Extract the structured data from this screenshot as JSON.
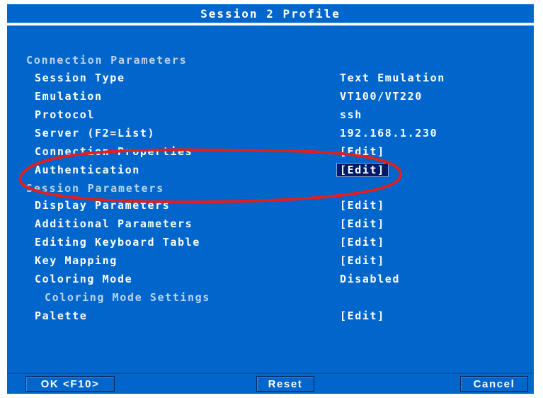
{
  "window": {
    "title": "Session 2 Profile"
  },
  "sections": {
    "connection": "Connection Parameters",
    "session": "Session Parameters"
  },
  "connection_rows": [
    {
      "label": "Session Type",
      "value": "Text Emulation"
    },
    {
      "label": "Emulation",
      "value": "VT100/VT220"
    },
    {
      "label": "Protocol",
      "value": "ssh"
    },
    {
      "label": "Server (F2=List)",
      "value": "192.168.1.230"
    },
    {
      "label": "Connection Properties",
      "value": "[Edit]"
    },
    {
      "label": "Authentication",
      "value": "[Edit]",
      "selected": true
    }
  ],
  "session_rows": [
    {
      "label": "Display Parameters",
      "value": "[Edit]"
    },
    {
      "label": "Additional Parameters",
      "value": "[Edit]"
    },
    {
      "label": "Editing Keyboard Table",
      "value": "[Edit]"
    },
    {
      "label": "Key Mapping",
      "value": "[Edit]"
    },
    {
      "label": "Coloring Mode",
      "value": "Disabled"
    },
    {
      "label": "Coloring Mode Settings",
      "value": ""
    },
    {
      "label": "Palette",
      "value": "[Edit]"
    }
  ],
  "footer": {
    "ok_label": "OK <F10>",
    "reset_label": "Reset",
    "cancel_label": "Cancel"
  },
  "colors": {
    "panel_background": "#0066cc",
    "selected_background": "#001a66",
    "annotation_ring": "#e02020"
  }
}
